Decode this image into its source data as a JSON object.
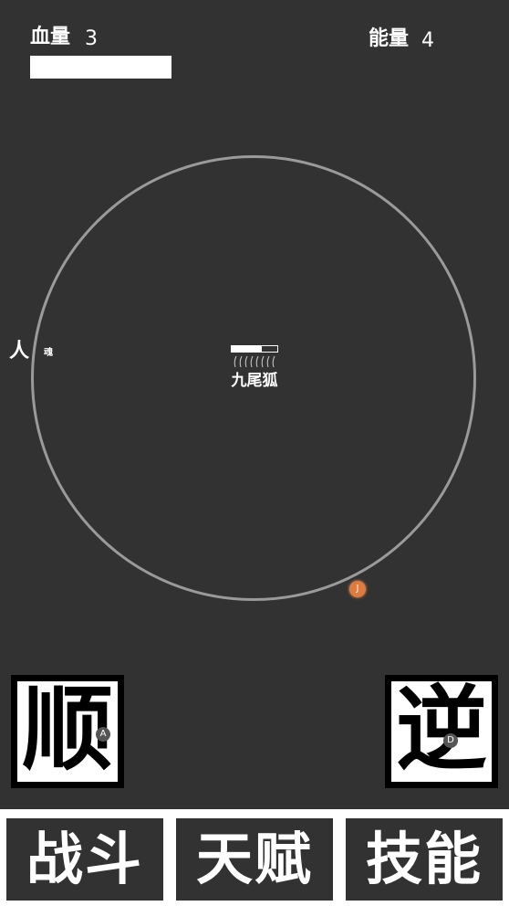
{
  "hud": {
    "hp_label": "血量",
    "hp_value": "3",
    "hp_fill": 1.0,
    "energy_label": "能量",
    "energy_value": "4"
  },
  "arena": {
    "player": {
      "char": "人",
      "soul": "魂"
    },
    "boss": {
      "name": "九尾狐",
      "hp_fraction": 0.65
    },
    "orb_key": "J"
  },
  "controls": {
    "clockwise": {
      "glyph": "顺",
      "key": "A"
    },
    "counterclockwise": {
      "glyph": "逆",
      "key": "D"
    }
  },
  "menu": {
    "tabs": [
      {
        "label": "战斗"
      },
      {
        "label": "天赋"
      },
      {
        "label": "技能"
      }
    ]
  },
  "colors": {
    "background": "#323232",
    "ring": "#9a9a9a",
    "orb": "#e07a3e",
    "foreground": "#ffffff"
  }
}
